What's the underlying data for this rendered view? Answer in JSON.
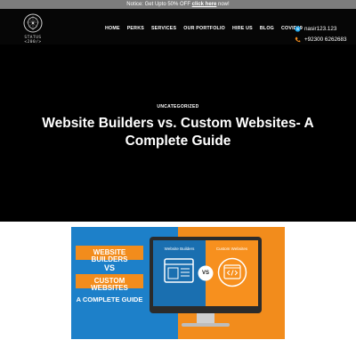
{
  "notice": {
    "prefix": "Notice: Get Upto 50% OFF ",
    "link": "click here",
    "suffix": " now!"
  },
  "header": {
    "logo_text": "STATUS <200/>",
    "nav": [
      "HOME",
      "PERKS",
      "SERVICES",
      "OUR PORTFOLIO",
      "HIRE US",
      "BLOG",
      "COVID19"
    ],
    "contact": {
      "skype": "nasir123.123",
      "phone": "+92300 6262683"
    }
  },
  "hero": {
    "category": "UNCATEGORIZED",
    "title": "Website Builders vs. Custom Websites- A Complete Guide"
  },
  "featured_image": {
    "line1": "WEBSITE BUILDERS",
    "line2": "VS",
    "line3": "CUSTOM WEBSITES",
    "line4": "A COMPLETE GUIDE",
    "screen_left": "Website Builders",
    "screen_vs": "VS",
    "screen_right": "Custom Websites",
    "colors": {
      "blue": "#1d80c9",
      "orange": "#f28c1c"
    }
  },
  "icons": {
    "logo": "brain-circuit-icon",
    "skype": "skype-icon",
    "phone": "phone-icon"
  }
}
